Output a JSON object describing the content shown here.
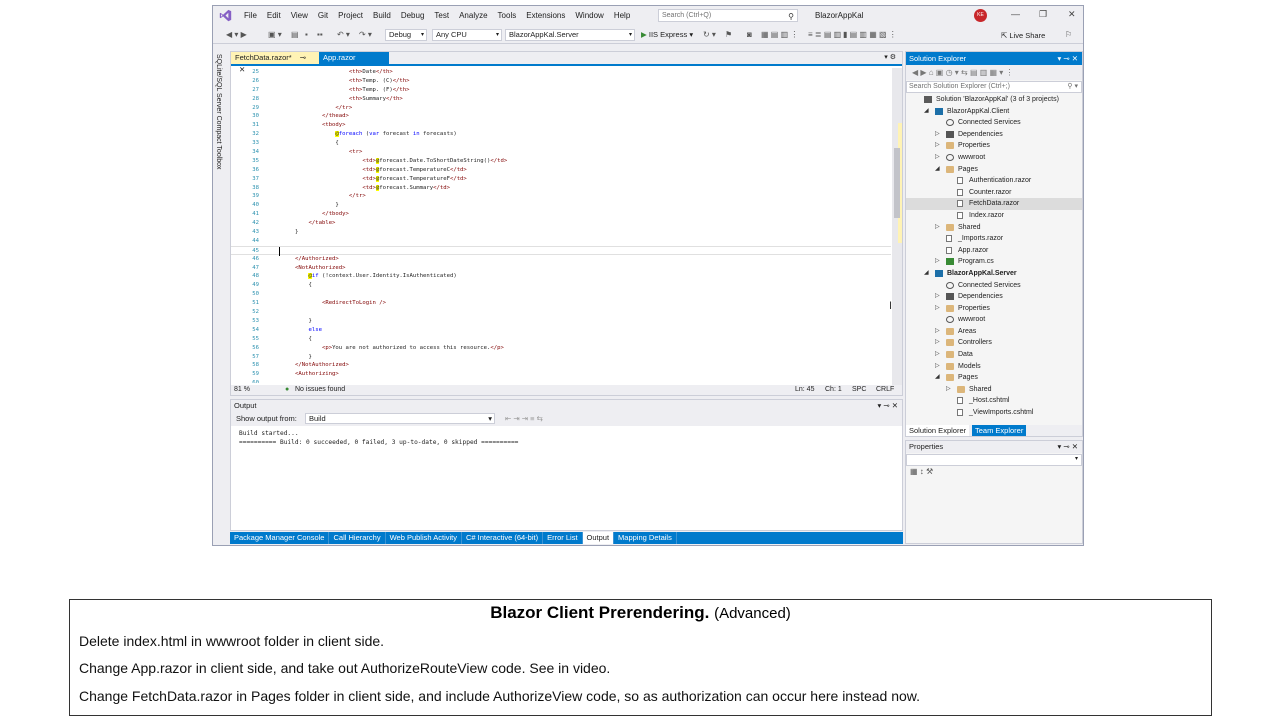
{
  "titlebar": {
    "menus": [
      "File",
      "Edit",
      "View",
      "Git",
      "Project",
      "Build",
      "Debug",
      "Test",
      "Analyze",
      "Tools",
      "Extensions",
      "Window",
      "Help"
    ],
    "search_placeholder": "Search (Ctrl+Q)",
    "solution_name": "BlazorAppKal",
    "avatar_initials": "KE"
  },
  "toolbar": {
    "config": "Debug",
    "platform": "Any CPU",
    "startup_project": "BlazorAppKal.Server",
    "run_target": "IIS Express",
    "live_share": "Live Share"
  },
  "left_tab": "SQLite/SQL Server Compact Toolbox",
  "editor": {
    "tabs": [
      {
        "label": "FetchData.razor*",
        "active": true
      },
      {
        "label": "App.razor",
        "active": false
      }
    ],
    "lines": [
      {
        "n": "25",
        "t": "                <th>Date</th>"
      },
      {
        "n": "26",
        "t": "                <th>Temp. (C)</th>"
      },
      {
        "n": "27",
        "t": "                <th>Temp. (F)</th>"
      },
      {
        "n": "28",
        "t": "                <th>Summary</th>"
      },
      {
        "n": "29",
        "t": "            </tr>"
      },
      {
        "n": "30",
        "t": "        </thead>"
      },
      {
        "n": "31",
        "t": "        <tbody>"
      },
      {
        "n": "32",
        "t": "            @foreach (var forecast in forecasts)"
      },
      {
        "n": "33",
        "t": "            {"
      },
      {
        "n": "34",
        "t": "                <tr>"
      },
      {
        "n": "35",
        "t": "                    <td>@forecast.Date.ToShortDateString()</td>"
      },
      {
        "n": "36",
        "t": "                    <td>@forecast.TemperatureC</td>"
      },
      {
        "n": "37",
        "t": "                    <td>@forecast.TemperatureF</td>"
      },
      {
        "n": "38",
        "t": "                    <td>@forecast.Summary</td>"
      },
      {
        "n": "39",
        "t": "                </tr>"
      },
      {
        "n": "40",
        "t": "            }"
      },
      {
        "n": "41",
        "t": "        </tbody>"
      },
      {
        "n": "42",
        "t": "    </table>"
      },
      {
        "n": "43",
        "t": "}"
      },
      {
        "n": "44",
        "t": ""
      },
      {
        "n": "45",
        "t": ""
      },
      {
        "n": "46",
        "t": "</Authorized>"
      },
      {
        "n": "47",
        "t": "<NotAuthorized>"
      },
      {
        "n": "48",
        "t": "    @if (!context.User.Identity.IsAuthenticated)"
      },
      {
        "n": "49",
        "t": "    {"
      },
      {
        "n": "50",
        "t": ""
      },
      {
        "n": "51",
        "t": "        <RedirectToLogin />"
      },
      {
        "n": "52",
        "t": ""
      },
      {
        "n": "53",
        "t": "    }"
      },
      {
        "n": "54",
        "t": "    else"
      },
      {
        "n": "55",
        "t": "    {"
      },
      {
        "n": "56",
        "t": "        <p>You are not authorized to access this resource.</p>"
      },
      {
        "n": "57",
        "t": "    }"
      },
      {
        "n": "58",
        "t": "</NotAuthorized>"
      },
      {
        "n": "59",
        "t": "<Authorizing>"
      },
      {
        "n": "60",
        "t": ""
      }
    ],
    "zoom": "81 %",
    "issues": "No issues found",
    "ln": "Ln: 45",
    "ch": "Ch: 1",
    "spc": "SPC",
    "crlf": "CRLF"
  },
  "output": {
    "title": "Output",
    "show_from_label": "Show output from:",
    "source": "Build",
    "text": "Build started...\n========== Build: 0 succeeded, 0 failed, 3 up-to-date, 0 skipped =========="
  },
  "bottom_tabs": [
    "Package Manager Console",
    "Call Hierarchy",
    "Web Publish Activity",
    "C# Interactive (64-bit)",
    "Error List",
    "Output",
    "Mapping Details"
  ],
  "solution_explorer": {
    "title": "Solution Explorer",
    "search_placeholder": "Search Solution Explorer (Ctrl+;)",
    "nodes": [
      {
        "label": "Solution 'BlazorAppKal' (3 of 3 projects)",
        "depth": 0,
        "exp": "",
        "icon": "solution"
      },
      {
        "label": "BlazorAppKal.Client",
        "depth": 1,
        "exp": "◢",
        "icon": "project"
      },
      {
        "label": "Connected Services",
        "depth": 2,
        "exp": "",
        "icon": "connected"
      },
      {
        "label": "Dependencies",
        "depth": 2,
        "exp": "▷",
        "icon": "deps"
      },
      {
        "label": "Properties",
        "depth": 2,
        "exp": "▷",
        "icon": "folder"
      },
      {
        "label": "wwwroot",
        "depth": 2,
        "exp": "▷",
        "icon": "globe"
      },
      {
        "label": "Pages",
        "depth": 2,
        "exp": "◢",
        "icon": "folder"
      },
      {
        "label": "Authentication.razor",
        "depth": 3,
        "exp": "",
        "icon": "file"
      },
      {
        "label": "Counter.razor",
        "depth": 3,
        "exp": "",
        "icon": "file"
      },
      {
        "label": "FetchData.razor",
        "depth": 3,
        "exp": "",
        "icon": "file",
        "selected": true
      },
      {
        "label": "Index.razor",
        "depth": 3,
        "exp": "",
        "icon": "file"
      },
      {
        "label": "Shared",
        "depth": 2,
        "exp": "▷",
        "icon": "folder"
      },
      {
        "label": "_Imports.razor",
        "depth": 2,
        "exp": "",
        "icon": "file"
      },
      {
        "label": "App.razor",
        "depth": 2,
        "exp": "",
        "icon": "file"
      },
      {
        "label": "Program.cs",
        "depth": 2,
        "exp": "▷",
        "icon": "cs"
      },
      {
        "label": "BlazorAppKal.Server",
        "depth": 1,
        "exp": "◢",
        "icon": "project",
        "bold": true
      },
      {
        "label": "Connected Services",
        "depth": 2,
        "exp": "",
        "icon": "connected"
      },
      {
        "label": "Dependencies",
        "depth": 2,
        "exp": "▷",
        "icon": "deps"
      },
      {
        "label": "Properties",
        "depth": 2,
        "exp": "▷",
        "icon": "folder"
      },
      {
        "label": "wwwroot",
        "depth": 2,
        "exp": "",
        "icon": "globe"
      },
      {
        "label": "Areas",
        "depth": 2,
        "exp": "▷",
        "icon": "folder"
      },
      {
        "label": "Controllers",
        "depth": 2,
        "exp": "▷",
        "icon": "folder"
      },
      {
        "label": "Data",
        "depth": 2,
        "exp": "▷",
        "icon": "folder"
      },
      {
        "label": "Models",
        "depth": 2,
        "exp": "▷",
        "icon": "folder"
      },
      {
        "label": "Pages",
        "depth": 2,
        "exp": "◢",
        "icon": "folder"
      },
      {
        "label": "Shared",
        "depth": 3,
        "exp": "▷",
        "icon": "folder"
      },
      {
        "label": "_Host.cshtml",
        "depth": 3,
        "exp": "",
        "icon": "file"
      },
      {
        "label": "_ViewImports.cshtml",
        "depth": 3,
        "exp": "",
        "icon": "file"
      }
    ],
    "tab_solution": "Solution Explorer",
    "tab_team": "Team Explorer"
  },
  "properties": {
    "title": "Properties"
  },
  "caption": {
    "title_bold": "Blazor Client Prerendering.",
    "title_rest": "(Advanced)",
    "line1": "Delete index.html in wwwroot folder in client side.",
    "line2": "Change App.razor in client side, and take out AuthorizeRouteView code. See in video.",
    "line3": "Change FetchData.razor in Pages folder in client side, and include AuthorizeView code, so as authorization can occur here instead now."
  },
  "colors": {
    "accent": "#007acc",
    "chrome": "#eeeef2",
    "active_tab": "#fff3b5"
  }
}
